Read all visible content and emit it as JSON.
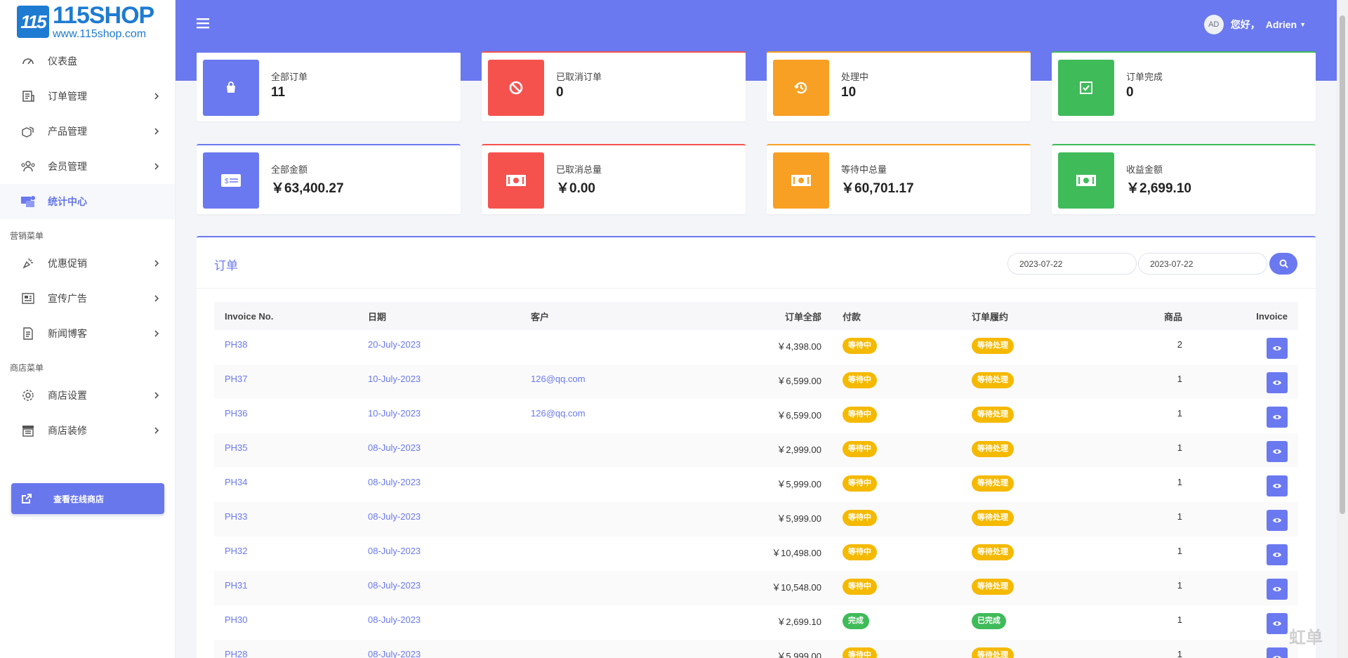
{
  "brand": {
    "name": "115SHOP",
    "url": "www.115shop.com",
    "mark": "115"
  },
  "sidebar": {
    "main_items": [
      {
        "label": "仪表盘",
        "icon": "gauge-icon",
        "chevron": false
      },
      {
        "label": "订单管理",
        "icon": "order-list-icon",
        "chevron": true
      },
      {
        "label": "产品管理",
        "icon": "boxes-icon",
        "chevron": true
      },
      {
        "label": "会员管理",
        "icon": "users-icon",
        "chevron": true
      },
      {
        "label": "统计中心",
        "icon": "stats-icon",
        "chevron": false,
        "active": true
      }
    ],
    "marketing_header": "营销菜单",
    "marketing_items": [
      {
        "label": "优惠促销",
        "icon": "promo-icon",
        "chevron": true
      },
      {
        "label": "宣传广告",
        "icon": "ad-icon",
        "chevron": true
      },
      {
        "label": "新闻博客",
        "icon": "news-icon",
        "chevron": true
      }
    ],
    "shop_header": "商店菜单",
    "shop_items": [
      {
        "label": "商店设置",
        "icon": "gear-icon",
        "chevron": true
      },
      {
        "label": "商店装修",
        "icon": "store-icon",
        "chevron": true
      }
    ],
    "shop_button": "查看在线商店"
  },
  "header": {
    "avatar_initials": "AD",
    "greeting": "您好，",
    "user_name": "Adrien"
  },
  "stats": [
    {
      "title": "全部订单",
      "value": "11",
      "color": "#6a79ef",
      "icon": "bag-icon"
    },
    {
      "title": "已取消订单",
      "value": "0",
      "color": "#f5524e",
      "icon": "ban-icon"
    },
    {
      "title": "处理中",
      "value": "10",
      "color": "#f8a023",
      "icon": "history-icon"
    },
    {
      "title": "订单完成",
      "value": "0",
      "color": "#3fbb5a",
      "icon": "check-square-icon"
    },
    {
      "title": "全部金额",
      "value": "￥63,400.27",
      "color": "#6a79ef",
      "icon": "card-icon"
    },
    {
      "title": "已取消总量",
      "value": "￥0.00",
      "color": "#f5524e",
      "icon": "cash-icon"
    },
    {
      "title": "等待中总量",
      "value": "￥60,701.17",
      "color": "#f8a023",
      "icon": "cash-icon"
    },
    {
      "title": "收益金额",
      "value": "￥2,699.10",
      "color": "#3fbb5a",
      "icon": "cash-icon"
    }
  ],
  "orders": {
    "title": "订单",
    "date_from": "2023-07-22",
    "date_to": "2023-07-22",
    "columns": [
      "Invoice No.",
      "日期",
      "客户",
      "订单全部",
      "付款",
      "订单履约",
      "商品",
      "Invoice"
    ],
    "rows": [
      {
        "invoice": "PH38",
        "date": "20-July-2023",
        "customer": "",
        "total": "￥4,398.00",
        "payment": "等待中",
        "payment_status": "warn",
        "fulfil": "等待处理",
        "fulfil_status": "warn",
        "items": "2"
      },
      {
        "invoice": "PH37",
        "date": "10-July-2023",
        "customer": "126@qq.com",
        "total": "￥6,599.00",
        "payment": "等待中",
        "payment_status": "warn",
        "fulfil": "等待处理",
        "fulfil_status": "warn",
        "items": "1"
      },
      {
        "invoice": "PH36",
        "date": "10-July-2023",
        "customer": "126@qq.com",
        "total": "￥6,599.00",
        "payment": "等待中",
        "payment_status": "warn",
        "fulfil": "等待处理",
        "fulfil_status": "warn",
        "items": "1"
      },
      {
        "invoice": "PH35",
        "date": "08-July-2023",
        "customer": "",
        "total": "￥2,999.00",
        "payment": "等待中",
        "payment_status": "warn",
        "fulfil": "等待处理",
        "fulfil_status": "warn",
        "items": "1"
      },
      {
        "invoice": "PH34",
        "date": "08-July-2023",
        "customer": "",
        "total": "￥5,999.00",
        "payment": "等待中",
        "payment_status": "warn",
        "fulfil": "等待处理",
        "fulfil_status": "warn",
        "items": "1"
      },
      {
        "invoice": "PH33",
        "date": "08-July-2023",
        "customer": "",
        "total": "￥5,999.00",
        "payment": "等待中",
        "payment_status": "warn",
        "fulfil": "等待处理",
        "fulfil_status": "warn",
        "items": "1"
      },
      {
        "invoice": "PH32",
        "date": "08-July-2023",
        "customer": "",
        "total": "￥10,498.00",
        "payment": "等待中",
        "payment_status": "warn",
        "fulfil": "等待处理",
        "fulfil_status": "warn",
        "items": "1"
      },
      {
        "invoice": "PH31",
        "date": "08-July-2023",
        "customer": "",
        "total": "￥10,548.00",
        "payment": "等待中",
        "payment_status": "warn",
        "fulfil": "等待处理",
        "fulfil_status": "warn",
        "items": "1"
      },
      {
        "invoice": "PH30",
        "date": "08-July-2023",
        "customer": "",
        "total": "￥2,699.10",
        "payment": "完成",
        "payment_status": "ok",
        "fulfil": "已完成",
        "fulfil_status": "ok",
        "items": "1"
      },
      {
        "invoice": "PH28",
        "date": "08-July-2023",
        "customer": "",
        "total": "￥5,999.00",
        "payment": "等待中",
        "payment_status": "warn",
        "fulfil": "等待处理",
        "fulfil_status": "warn",
        "items": "1"
      }
    ]
  },
  "watermark": "虹单"
}
